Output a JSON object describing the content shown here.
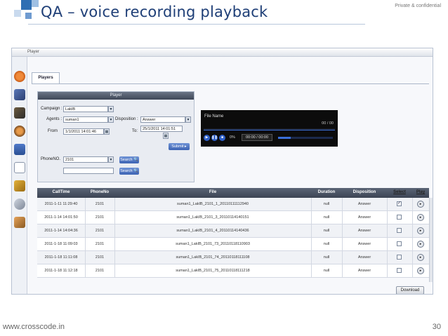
{
  "slide": {
    "title": "QA – voice recording playback",
    "confidential": "Private & confidential",
    "footer_url": "www.crosscode.in",
    "page_number": "30",
    "colors": {
      "title": "#1f3f77",
      "accent_square": "#2f6fb3",
      "light_square": "#9fc0e3"
    }
  },
  "app": {
    "window_title": "Player",
    "tab_label": "Players",
    "form": {
      "header": "Player",
      "campaign_label": "Campaign :",
      "campaign_value": "LakIB",
      "agents_label": "Agents :",
      "agents_value": "suman1",
      "disposition_label": "Disposition :",
      "disposition_value": "Answer",
      "from_label": "From",
      "from_value": "1/1/2011 14:01:46",
      "to_label": "To:",
      "to_value": "25/1/2011 14:01:51",
      "submit_label": "Submit ▸",
      "phone_label": "PhoneNO.",
      "phone_value": "2101",
      "search_label": "Search 🔍",
      "search2_label": "Search 🔍"
    },
    "player": {
      "file_name_label": "File Name",
      "total_time": "00 / 00",
      "percent": "0%",
      "current_time": "00:00 / 00:00"
    },
    "table": {
      "headers": [
        "CallTime",
        "PhoneNo",
        "File",
        "Duration",
        "Disposition",
        "Select",
        "Play"
      ],
      "rows": [
        {
          "calltime": "2011-1-11 11:29:40",
          "phone": "2101",
          "file": "suman1_LakIB_2101_1_20110111112940",
          "duration": "null",
          "disposition": "Answer",
          "checked": "✓"
        },
        {
          "calltime": "2011-1-14 14:01:50",
          "phone": "2101",
          "file": "suman1_LakIB_2101_3_20110114140151",
          "duration": "null",
          "disposition": "Answer",
          "checked": ""
        },
        {
          "calltime": "2011-1-14 14:04:36",
          "phone": "2101",
          "file": "suman1_LakIB_2101_4_20110114140436",
          "duration": "null",
          "disposition": "Answer",
          "checked": ""
        },
        {
          "calltime": "2011-1-18 11:09:03",
          "phone": "2101",
          "file": "suman1_LakIB_2101_73_20110118110903",
          "duration": "null",
          "disposition": "Answer",
          "checked": ""
        },
        {
          "calltime": "2011-1-18 11:11:08",
          "phone": "2101",
          "file": "suman1_LakIB_2101_74_20110118111108",
          "duration": "null",
          "disposition": "Answer",
          "checked": ""
        },
        {
          "calltime": "2011-1-18 11:12:18",
          "phone": "2101",
          "file": "suman1_LakIB_2101_75_20110118111218",
          "duration": "null",
          "disposition": "Answer",
          "checked": ""
        }
      ]
    },
    "download_label": "Download",
    "play_icon": "▸"
  }
}
